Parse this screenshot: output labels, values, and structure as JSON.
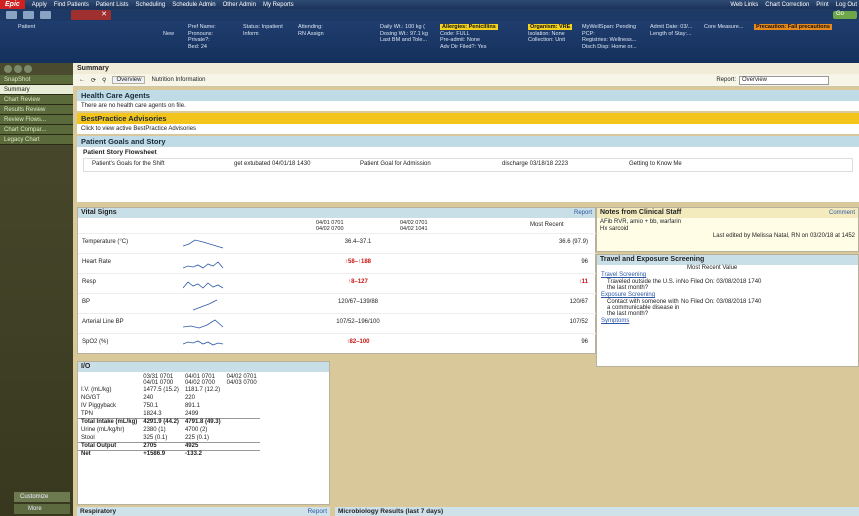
{
  "menubar": {
    "epic": "Epic",
    "items": [
      "Apply",
      "Find Patients",
      "Patient Lists",
      "Scheduling",
      "Schedule Admin",
      "Other Admin",
      "My Reports"
    ],
    "right": [
      "Web Links",
      "Chart Correction",
      "Print",
      "Log Out"
    ]
  },
  "tabbar": {
    "patient_tab": "",
    "search": "Go"
  },
  "header": {
    "patient_label": "Patient",
    "new": "New",
    "name": "Pref Name:",
    "pronouns": "Pronouns:",
    "private": "Private?:",
    "bed": "Bed: 24",
    "status": "Status: Inpatient",
    "infobar": "Inform",
    "attending": "Attending:",
    "rn": "RN Assign",
    "dailywt": "Daily Wt.: 100 kg (",
    "dosingwt": "Dosing Wt.: 97.1 kg",
    "lastbm": "Last BM and Tole...",
    "allergies": "Allergies: Penicillins",
    "code": "Code: FULL",
    "preadmit": "Pre-admit: None",
    "advdir": "Adv Dir Filed?: Yes",
    "organism": "Organism: VRE",
    "isolation": "Isolation: None",
    "collection": "Collection: Unit",
    "mywellspan": "MyWellSpan: Pending",
    "pcp": "PCP:",
    "registries": "Registries: Wellness...",
    "disch": "Disch Disp: Home or...",
    "admit": "Admit Date: 03/...",
    "los": "Length of Stay:...",
    "core": "Core Measure...",
    "precaution": "Precaution: Fall precautions"
  },
  "nav": {
    "items": [
      "SnapShot",
      "Summary",
      "Chart Review",
      "Results Review",
      "Review Flows...",
      "Chart Compar...",
      "Legacy Chart"
    ],
    "customize": "Customize",
    "more": "More"
  },
  "summary": {
    "title": "Summary",
    "overview_btn": "Overview",
    "nutrition_btn": "Nutrition Information",
    "report_label": "Report:",
    "report_value": "Overview"
  },
  "hca": {
    "title": "Health Care Agents",
    "body": "There are no health care agents on file."
  },
  "bpa": {
    "title": "BestPractice Advisories",
    "body": "Click to view active BestPractice Advisories"
  },
  "goals": {
    "title": "Patient Goals and Story",
    "sub": "Patient Story Flowsheet",
    "c1": "Patient's Goals for the Shift",
    "c2": "get extubated 04/01/18 1430",
    "c3": "Patient Goal for Admission",
    "c4": "discharge 03/18/18 2223",
    "c5": "Getting to Know Me"
  },
  "vitals": {
    "title": "Vital Signs",
    "report": "Report",
    "range1": "04/01 0701",
    "range1b": "04/02 0700",
    "range2": "04/02 0701",
    "range2b": "04/02 1041",
    "recent": "Most Recent",
    "rows": [
      {
        "name": "Temperature (°C)",
        "range": "36.4–37.1",
        "recent": "36.6 (97.9)",
        "rangeRed": false,
        "recentRed": false
      },
      {
        "name": "Heart Rate",
        "range": "↑58–↑188",
        "recent": "96",
        "rangeRed": true,
        "recentRed": false
      },
      {
        "name": "Resp",
        "range": "↑8–127",
        "recent": "↑11",
        "rangeRed": true,
        "recentRed": true
      },
      {
        "name": "BP",
        "range": "120/67–139/88",
        "recent": "120/67",
        "rangeRed": false,
        "recentRed": false
      },
      {
        "name": "Arterial Line BP",
        "range": "107/52–196/100",
        "recent": "107/52",
        "rangeRed": false,
        "recentRed": false
      },
      {
        "name": "SpO2 (%)",
        "range": "↑82–100",
        "recent": "96",
        "rangeRed": true,
        "recentRed": false
      }
    ]
  },
  "notes": {
    "title": "Notes from Clinical Staff",
    "comment": "Comment",
    "l1": "AFib RVR, amio + bb, warfarin",
    "l2": "Hx sarcoid",
    "edited": "Last edited by Melissa Natal, RN on 03/20/18 at 1452"
  },
  "travel": {
    "title": "Travel and Exposure Screening",
    "recent": "Most Recent Value",
    "ts": "Travel Screening",
    "q1": "Traveled outside the U.S. in the last month?",
    "a1": "No Filed On: 03/08/2018 1740",
    "es": "Exposure Screening",
    "q2": "Contact with someone with a communicable disease in the last month?",
    "a2": "No Filed On: 03/08/2018 1740",
    "sym": "Symptoms"
  },
  "io": {
    "title": "I/O",
    "h1": "03/31 0701",
    "h1b": "04/01 0700",
    "h2": "04/01 0701",
    "h2b": "04/02 0700",
    "h3": "04/02 0701",
    "h3b": "04/03 0700",
    "rows": [
      [
        "I.V. (mL/kg)",
        "1477.5 (15.2)",
        "1181.7 (12.2)"
      ],
      [
        "NG/GT",
        "240",
        "220"
      ],
      [
        "IV Piggyback",
        "750.1",
        "891.1"
      ],
      [
        "TPN",
        "1824.3",
        "2499"
      ]
    ],
    "ti": "Total Intake (mL/kg)",
    "ti1": "4291.9 (44.2)",
    "ti2": "4791.8 (49.3)",
    "rows2": [
      [
        "Urine (mL/kg/hr)",
        "2380 (1)",
        "4700 (2)"
      ],
      [
        "Stool",
        "325 (0.1)",
        "225 (0.1)"
      ]
    ],
    "to": "Total Output",
    "to1": "2705",
    "to2": "4925",
    "net": "Net",
    "net1": "+1586.9",
    "net2": "-133.2"
  },
  "bottom": {
    "resp": "Respiratory",
    "report": "Report",
    "micro": "Microbiology Results (last 7 days)"
  }
}
